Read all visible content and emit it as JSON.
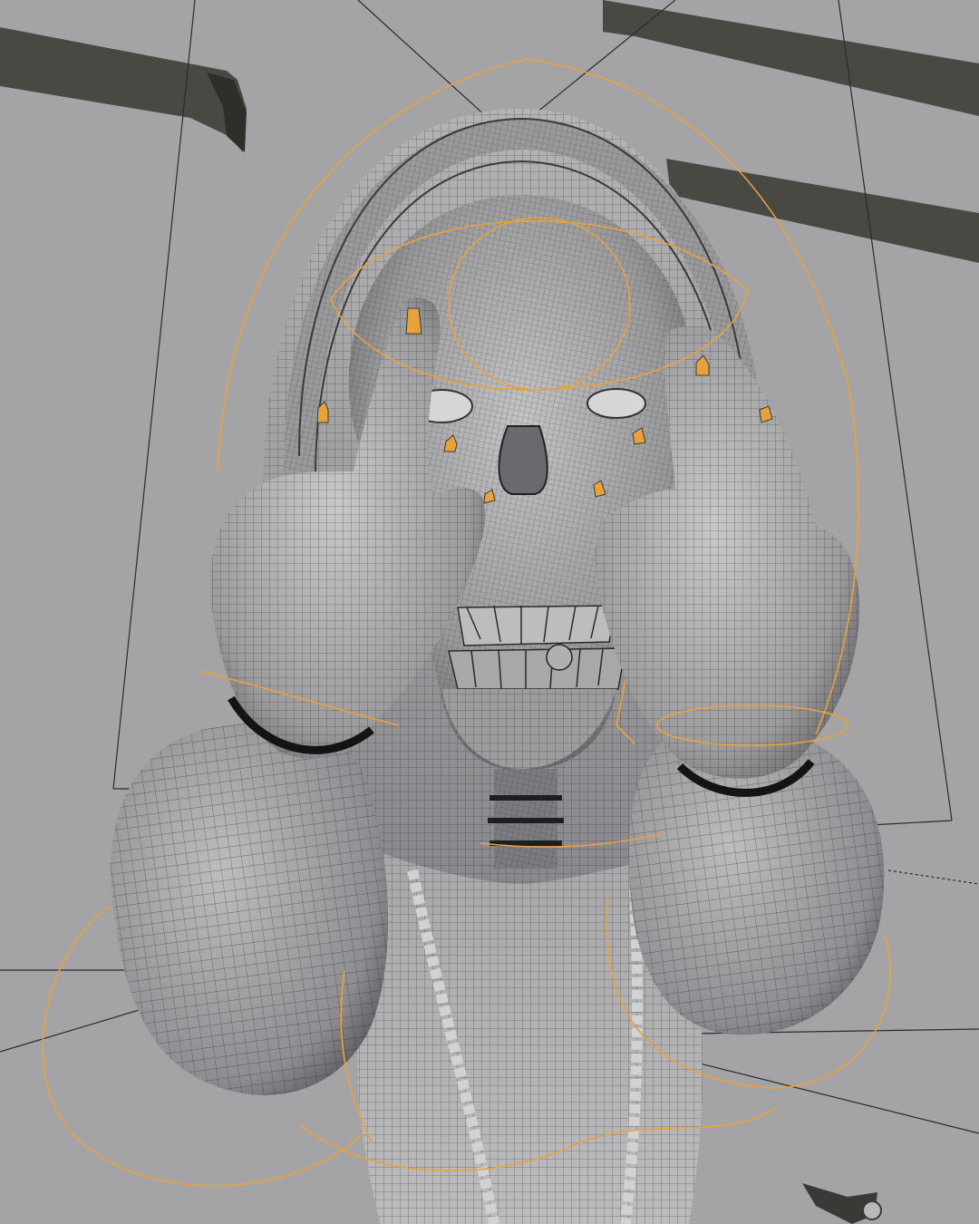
{
  "viewport": {
    "background_color": "#a4a4a6",
    "mesh_base_color": "#9c9c9e",
    "mesh_highlight_color": "#c2c2c4",
    "mesh_shadow_color": "#5e5e62",
    "wire_color": "#222226",
    "rig_color": "#e8a23c",
    "frame_line_color": "#2b2b2f"
  },
  "subject": {
    "icons": {
      "skull": "skull-icon",
      "hood": "hood-icon",
      "hand": "hand-icon",
      "wrist_band": "wrist-band-icon",
      "chain": "chain-icon",
      "control_curve": "rig-control-curve-icon",
      "bone_locator": "bone-locator-icon",
      "camera": "camera-icon"
    }
  }
}
